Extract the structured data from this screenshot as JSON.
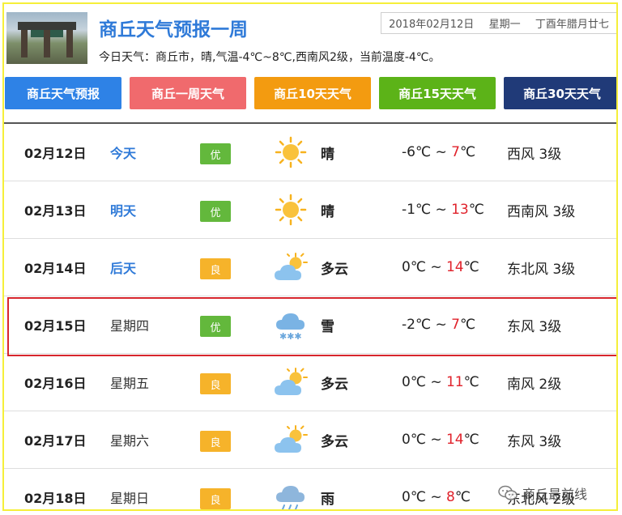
{
  "header": {
    "title": "商丘天气预报一周",
    "date": "2018年02月12日",
    "weekday": "星期一",
    "lunar": "丁酉年腊月廿七",
    "summary": "今日天气：商丘市，晴,气温-4℃~8℃,西南风2级，当前温度-4℃。"
  },
  "tabs": [
    {
      "label": "商丘天气预报",
      "color": "#2e82e6"
    },
    {
      "label": "商丘一周天气",
      "color": "#f06a6d"
    },
    {
      "label": "商丘10天天气",
      "color": "#f39b10"
    },
    {
      "label": "商丘15天天气",
      "color": "#5cb318"
    },
    {
      "label": "商丘30天天气",
      "color": "#203a78"
    }
  ],
  "rows": [
    {
      "date": "02月12日",
      "day": "今天",
      "aqi": "优",
      "icon": "sun-icon",
      "weather": "晴",
      "low": "-6℃",
      "sep": " ~ ",
      "high": "7",
      "unit": "℃",
      "wind": "西风 3级"
    },
    {
      "date": "02月13日",
      "day": "明天",
      "aqi": "优",
      "icon": "sun-icon",
      "weather": "晴",
      "low": "-1℃",
      "sep": " ~ ",
      "high": "13",
      "unit": "℃",
      "wind": "西南风 3级"
    },
    {
      "date": "02月14日",
      "day": "后天",
      "aqi": "良",
      "icon": "partly-cloudy-icon",
      "weather": "多云",
      "low": "0℃",
      "sep": " ~ ",
      "high": "14",
      "unit": "℃",
      "wind": "东北风 3级"
    },
    {
      "date": "02月15日",
      "day": "星期四",
      "aqi": "优",
      "icon": "snow-icon",
      "weather": "雪",
      "low": "-2℃",
      "sep": " ~ ",
      "high": "7",
      "unit": "℃",
      "wind": "东风 3级"
    },
    {
      "date": "02月16日",
      "day": "星期五",
      "aqi": "良",
      "icon": "partly-cloudy-icon",
      "weather": "多云",
      "low": "0℃",
      "sep": " ~ ",
      "high": "11",
      "unit": "℃",
      "wind": "南风 2级"
    },
    {
      "date": "02月17日",
      "day": "星期六",
      "aqi": "良",
      "icon": "partly-cloudy-icon",
      "weather": "多云",
      "low": "0℃",
      "sep": " ~ ",
      "high": "14",
      "unit": "℃",
      "wind": "东风 3级"
    },
    {
      "date": "02月18日",
      "day": "星期日",
      "aqi": "良",
      "icon": "rain-icon",
      "weather": "雨",
      "low": "0℃",
      "sep": " ~ ",
      "high": "8",
      "unit": "℃",
      "wind": "东北风 2级"
    }
  ],
  "watermark": {
    "text": "商丘最前线",
    "icon": "wechat-icon"
  }
}
